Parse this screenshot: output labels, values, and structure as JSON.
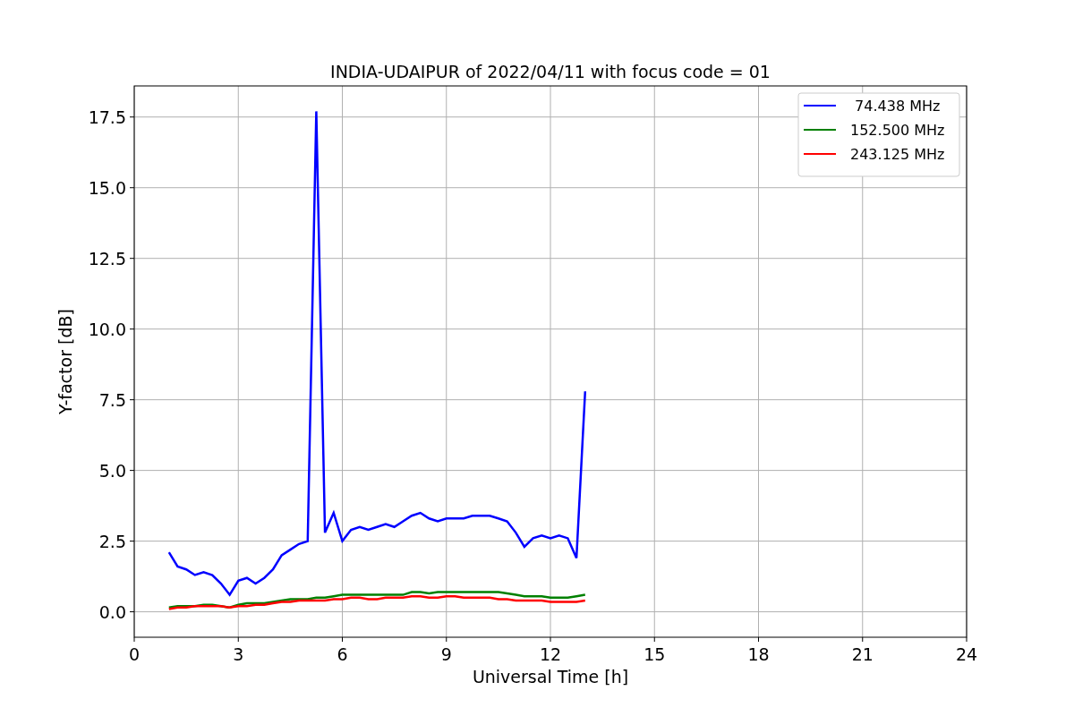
{
  "figure": {
    "chart_data": {
      "type": "line",
      "title": "INDIA-UDAIPUR of 2022/04/11 with focus code = 01",
      "xlabel": "Universal Time [h]",
      "ylabel": "Y-factor [dB]",
      "x": [
        1.0,
        1.25,
        1.5,
        1.75,
        2.0,
        2.25,
        2.5,
        2.75,
        3.0,
        3.25,
        3.5,
        3.75,
        4.0,
        4.25,
        4.5,
        4.75,
        5.0,
        5.25,
        5.5,
        5.75,
        6.0,
        6.25,
        6.5,
        6.75,
        7.0,
        7.25,
        7.5,
        7.75,
        8.0,
        8.25,
        8.5,
        8.75,
        9.0,
        9.25,
        9.5,
        9.75,
        10.0,
        10.25,
        10.5,
        10.75,
        11.0,
        11.25,
        11.5,
        11.75,
        12.0,
        12.25,
        12.5,
        12.75,
        13.0
      ],
      "series": [
        {
          "name": " 74.438 MHz",
          "color": "#0000ff",
          "values": [
            2.1,
            1.6,
            1.5,
            1.3,
            1.4,
            1.3,
            1.0,
            0.6,
            1.1,
            1.2,
            1.0,
            1.2,
            1.5,
            2.0,
            2.2,
            2.4,
            2.5,
            17.7,
            2.8,
            3.5,
            2.5,
            2.9,
            3.0,
            2.9,
            3.0,
            3.1,
            3.0,
            3.2,
            3.4,
            3.5,
            3.3,
            3.2,
            3.3,
            3.3,
            3.3,
            3.4,
            3.4,
            3.4,
            3.3,
            3.2,
            2.8,
            2.3,
            2.6,
            2.7,
            2.6,
            2.7,
            2.6,
            1.9,
            7.8
          ]
        },
        {
          "name": "152.500 MHz",
          "color": "#008000",
          "values": [
            0.15,
            0.2,
            0.2,
            0.2,
            0.25,
            0.25,
            0.2,
            0.15,
            0.25,
            0.3,
            0.3,
            0.3,
            0.35,
            0.4,
            0.45,
            0.45,
            0.45,
            0.5,
            0.5,
            0.55,
            0.6,
            0.6,
            0.6,
            0.6,
            0.6,
            0.6,
            0.6,
            0.6,
            0.7,
            0.7,
            0.65,
            0.7,
            0.7,
            0.7,
            0.7,
            0.7,
            0.7,
            0.7,
            0.7,
            0.65,
            0.6,
            0.55,
            0.55,
            0.55,
            0.5,
            0.5,
            0.5,
            0.55,
            0.6
          ]
        },
        {
          "name": "243.125 MHz",
          "color": "#ff0000",
          "values": [
            0.1,
            0.15,
            0.15,
            0.2,
            0.2,
            0.2,
            0.2,
            0.15,
            0.2,
            0.2,
            0.25,
            0.25,
            0.3,
            0.35,
            0.35,
            0.4,
            0.4,
            0.4,
            0.4,
            0.45,
            0.45,
            0.5,
            0.5,
            0.45,
            0.45,
            0.5,
            0.5,
            0.5,
            0.55,
            0.55,
            0.5,
            0.5,
            0.55,
            0.55,
            0.5,
            0.5,
            0.5,
            0.5,
            0.45,
            0.45,
            0.4,
            0.4,
            0.4,
            0.4,
            0.35,
            0.35,
            0.35,
            0.35,
            0.4
          ]
        }
      ],
      "grid": true,
      "legend": "upper right",
      "xlim": [
        0,
        24
      ],
      "ylim": [
        -0.9,
        18.6
      ],
      "xticks": [
        0,
        3,
        6,
        9,
        12,
        15,
        18,
        21,
        24
      ],
      "yticks": [
        {
          "value": 0,
          "label": "0.0"
        },
        {
          "value": 2.5,
          "label": "2.5"
        },
        {
          "value": 5,
          "label": "5.0"
        },
        {
          "value": 7.5,
          "label": "7.5"
        },
        {
          "value": 10,
          "label": "10.0"
        },
        {
          "value": 12.5,
          "label": "12.5"
        },
        {
          "value": 15,
          "label": "15.0"
        },
        {
          "value": 17.5,
          "label": "17.5"
        }
      ]
    }
  }
}
